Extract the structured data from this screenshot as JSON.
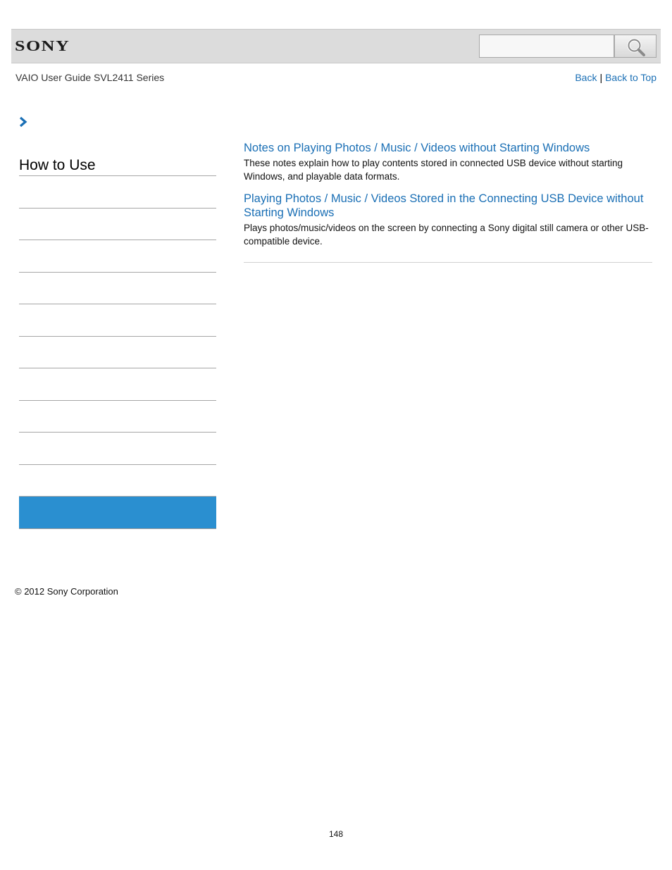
{
  "header": {
    "logo_text": "SONY",
    "search_placeholder": "",
    "search_icon": "magnifier-icon"
  },
  "nav": {
    "guide_title": "VAIO User Guide SVL2411 Series",
    "back_label": "Back",
    "separator": "|",
    "back_to_top_label": "Back to Top"
  },
  "breadcrumb_icon": "chevron-right-icon",
  "sidebar": {
    "heading": "How to Use",
    "items": [
      {
        "label": ""
      },
      {
        "label": ""
      },
      {
        "label": ""
      },
      {
        "label": ""
      },
      {
        "label": ""
      },
      {
        "label": ""
      },
      {
        "label": ""
      },
      {
        "label": ""
      },
      {
        "label": ""
      },
      {
        "label": ""
      },
      {
        "label": ""
      }
    ],
    "selected_color": "#2a8fd0"
  },
  "topics": [
    {
      "title": "Notes on Playing Photos / Music / Videos without Starting Windows",
      "description": "These notes explain how to play contents stored in connected USB device without starting Windows, and playable data formats."
    },
    {
      "title": "Playing Photos / Music / Videos Stored in the Connecting USB Device without Starting Windows",
      "description": "Plays photos/music/videos on the screen by connecting a Sony digital still camera or other USB-compatible device."
    }
  ],
  "footer": {
    "copyright": "© 2012 Sony Corporation",
    "page_number": "148"
  },
  "colors": {
    "link": "#1a6fb5",
    "header_bg": "#dcdcdc"
  }
}
